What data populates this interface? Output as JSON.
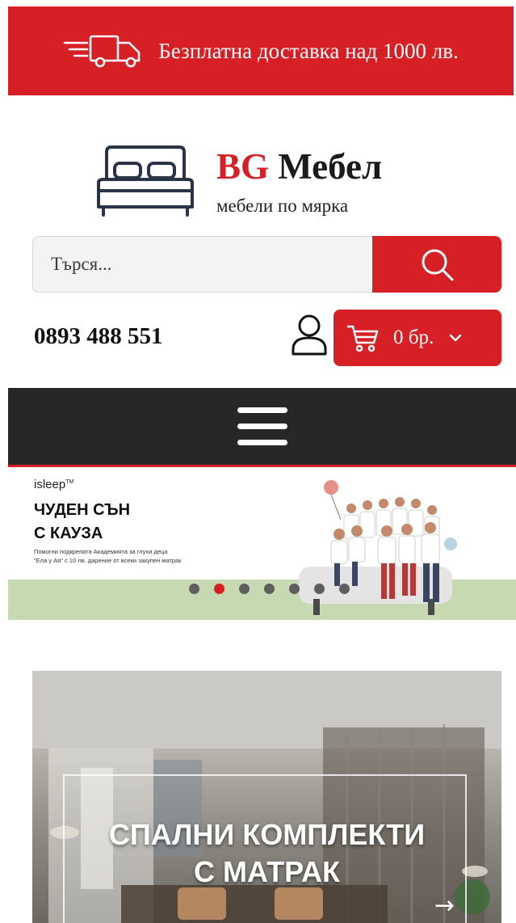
{
  "top_banner": {
    "text": "Безплатна доставка над 1000 лв.",
    "icon": "delivery-truck-icon"
  },
  "logo": {
    "brand_accent": "BG",
    "brand_name": "Мебел",
    "tagline": "мебели по мярка",
    "icon": "bed-icon"
  },
  "search": {
    "placeholder": "Търся...",
    "button_icon": "search-icon"
  },
  "contact": {
    "phone": "0893 488 551"
  },
  "account": {
    "icon": "user-icon"
  },
  "cart": {
    "count_label": "0 бр.",
    "icon": "cart-icon",
    "dropdown_icon": "chevron-down-icon"
  },
  "nav": {
    "menu_icon": "hamburger-menu-icon"
  },
  "slider": {
    "brand": "isleep",
    "brand_mark": "TM",
    "headline_line1": "ЧУДЕН СЪН",
    "headline_line2": "С КАУЗА",
    "fine_line1": "Помогни подкрепата Академията за глухи деца",
    "fine_line2": "\"Ела у Ая\" с 10 лв. дарение от всеки закупен матрак",
    "slide_count": 7,
    "active_slide": 2
  },
  "category": {
    "title_line1": "СПАЛНИ КОМПЛЕКТИ",
    "title_line2": "С МАТРАК",
    "arrow": "→"
  },
  "colors": {
    "accent": "#d71f26",
    "nav_bg": "#272727",
    "banner_band": "#c6d9b1"
  }
}
